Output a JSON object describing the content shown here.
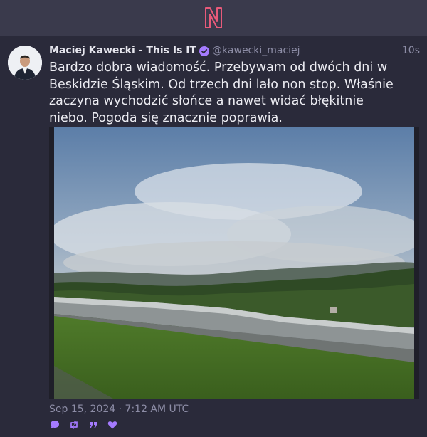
{
  "app": {
    "logo_letter": "N",
    "accent": "#e85a7a"
  },
  "post": {
    "author_name": "Maciej Kawecki - This Is IT",
    "handle": "@kawecki_maciej",
    "relative_time": "10s",
    "text": "Bardzo dobra wiadomość. Przebywam od dwóch dni w Beskidzie Śląskim. Od trzech dni lało non stop. Właśnie zaczyna wychodzić słońce a nawet widać błękitnie niebo. Pogoda się znacznie poprawia.",
    "date": "Sep 15, 2024 · 7:12 AM UTC",
    "verified_color": "#a57bff",
    "action_color": "#a57bff",
    "actions": [
      "reply-icon",
      "retweet-icon",
      "quote-icon",
      "like-icon"
    ]
  }
}
